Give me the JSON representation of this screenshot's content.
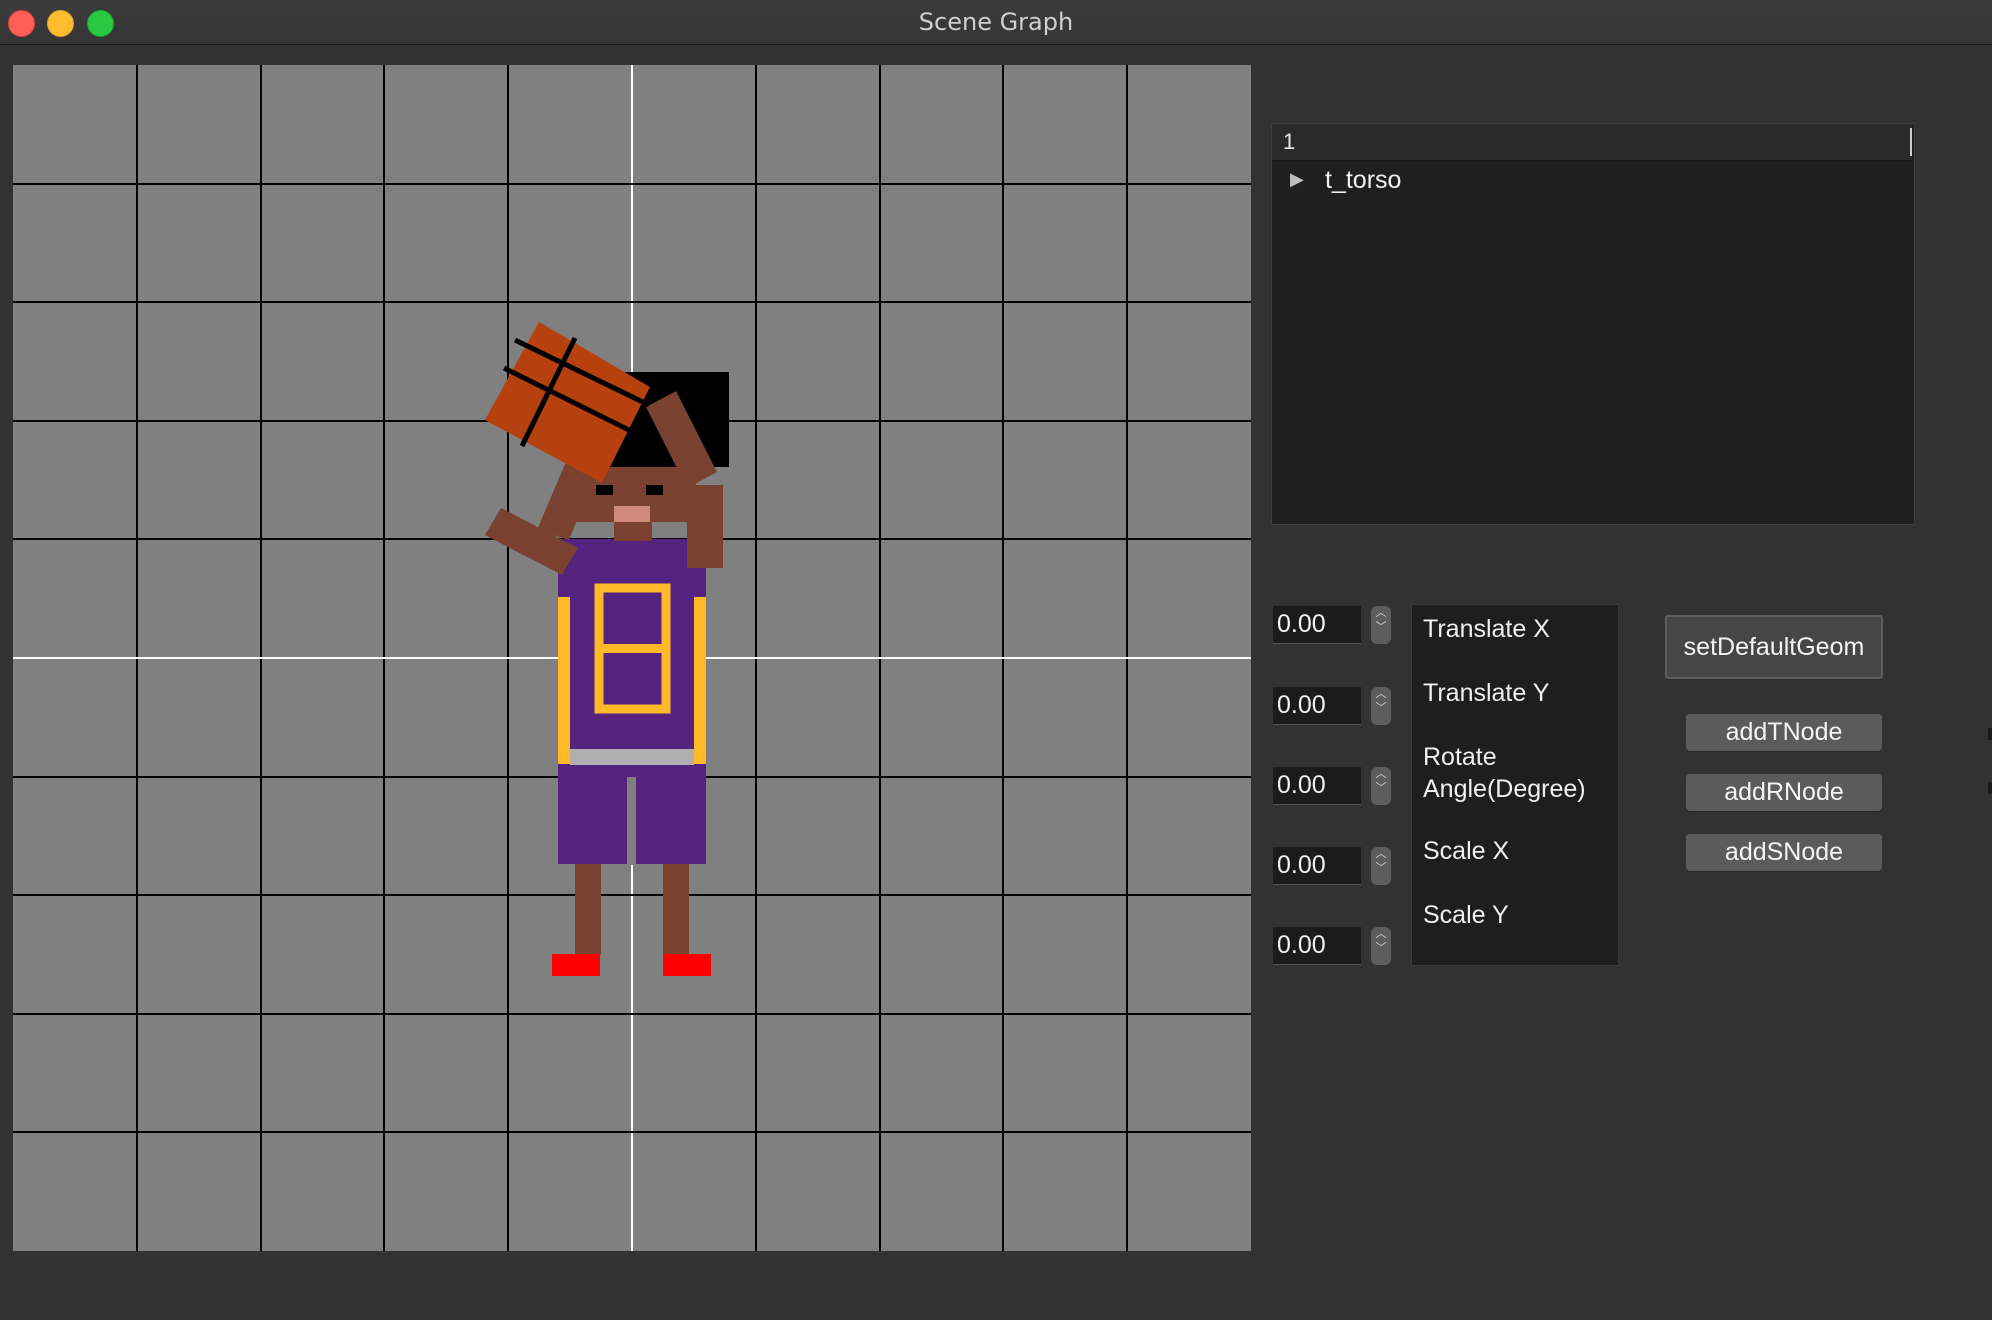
{
  "window": {
    "title": "Scene Graph"
  },
  "scene": {
    "colors": {
      "canvas": "#808080",
      "grid_lines": "#000000",
      "axis_lines": "#ffffff",
      "skin": "#7a4030",
      "hair": "#000000",
      "jersey": "#55237f",
      "jersey_trim": "#fdb927",
      "waistband": "#b0b0b0",
      "shoes": "#ff0000",
      "ball": "#b7410e",
      "mouth": "#d08a7a"
    },
    "jersey_number": "8"
  },
  "tree": {
    "header": "1",
    "items": [
      {
        "label": "t_torso"
      }
    ]
  },
  "params": [
    {
      "label": "Translate X",
      "value": "0.00"
    },
    {
      "label": "Translate Y",
      "value": "0.00"
    },
    {
      "label": "Rotate Angle(Degree)",
      "value": "0.00"
    },
    {
      "label": "Scale X",
      "value": "0.00"
    },
    {
      "label": "Scale Y",
      "value": "0.00"
    }
  ],
  "buttons": {
    "set_default": "setDefaultGeom",
    "add_t": "addTNode",
    "add_r": "addRNode",
    "add_s": "addSNode"
  }
}
